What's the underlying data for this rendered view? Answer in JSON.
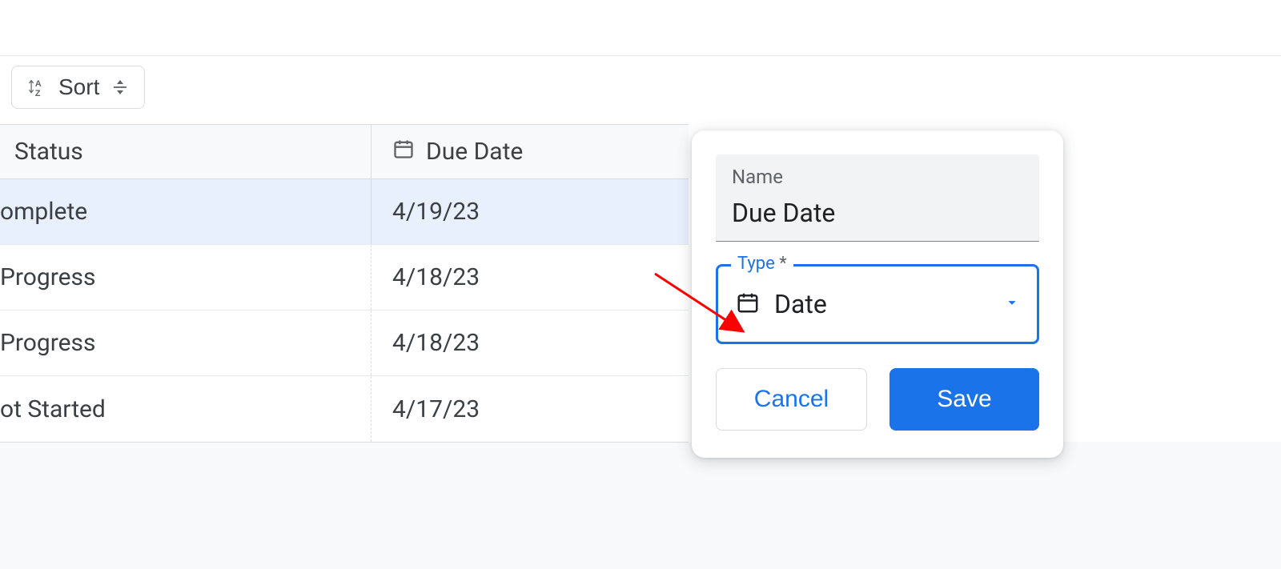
{
  "toolbar": {
    "sort_label": "Sort"
  },
  "table": {
    "columns": {
      "status": "Status",
      "due_date": "Due Date"
    },
    "rows": [
      {
        "status": "omplete",
        "due_date": "4/19/23",
        "selected": true
      },
      {
        "status": "Progress",
        "due_date": "4/18/23",
        "selected": false
      },
      {
        "status": "Progress",
        "due_date": "4/18/23",
        "selected": false
      },
      {
        "status": "ot Started",
        "due_date": "4/17/23",
        "selected": false
      }
    ]
  },
  "popover": {
    "name_label": "Name",
    "name_value": "Due Date",
    "type_label": "Type",
    "type_required_mark": "*",
    "type_value": "Date",
    "cancel_label": "Cancel",
    "save_label": "Save"
  },
  "colors": {
    "primary": "#1a73e8",
    "text": "#3c4043",
    "muted": "#5f6368",
    "arrow": "#ff0000"
  }
}
